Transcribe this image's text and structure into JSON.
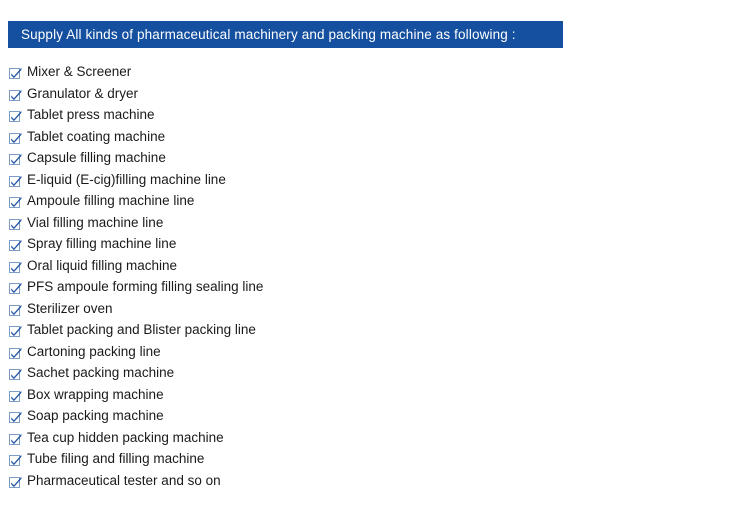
{
  "banner": {
    "title": "Supply All kinds of pharmaceutical machinery and packing machine as following :",
    "background_color": "#14509F",
    "text_color": "#FFFFFF"
  },
  "list": {
    "bullet_icon": "checkbox-check-icon",
    "bullet_color": "#2255A4",
    "text_color": "#1A1A1A",
    "items": [
      {
        "label": "Mixer & Screener"
      },
      {
        "label": "Granulator & dryer"
      },
      {
        "label": "Tablet press machine"
      },
      {
        "label": "Tablet coating machine"
      },
      {
        "label": "Capsule filling machine"
      },
      {
        "label": "E-liquid (E-cig)filling machine line"
      },
      {
        "label": "Ampoule filling machine line"
      },
      {
        "label": "Vial filling machine line"
      },
      {
        "label": "Spray filling machine line"
      },
      {
        "label": "Oral liquid filling machine"
      },
      {
        "label": "PFS ampoule forming filling sealing line"
      },
      {
        "label": "Sterilizer oven"
      },
      {
        "label": "Tablet packing and Blister packing line"
      },
      {
        "label": "Cartoning packing line"
      },
      {
        "label": "Sachet packing machine"
      },
      {
        "label": "Box wrapping machine"
      },
      {
        "label": "Soap packing machine"
      },
      {
        "label": "Tea cup hidden packing machine"
      },
      {
        "label": "Tube filing and filling machine"
      },
      {
        "label": "Pharmaceutical tester and so on"
      }
    ]
  }
}
